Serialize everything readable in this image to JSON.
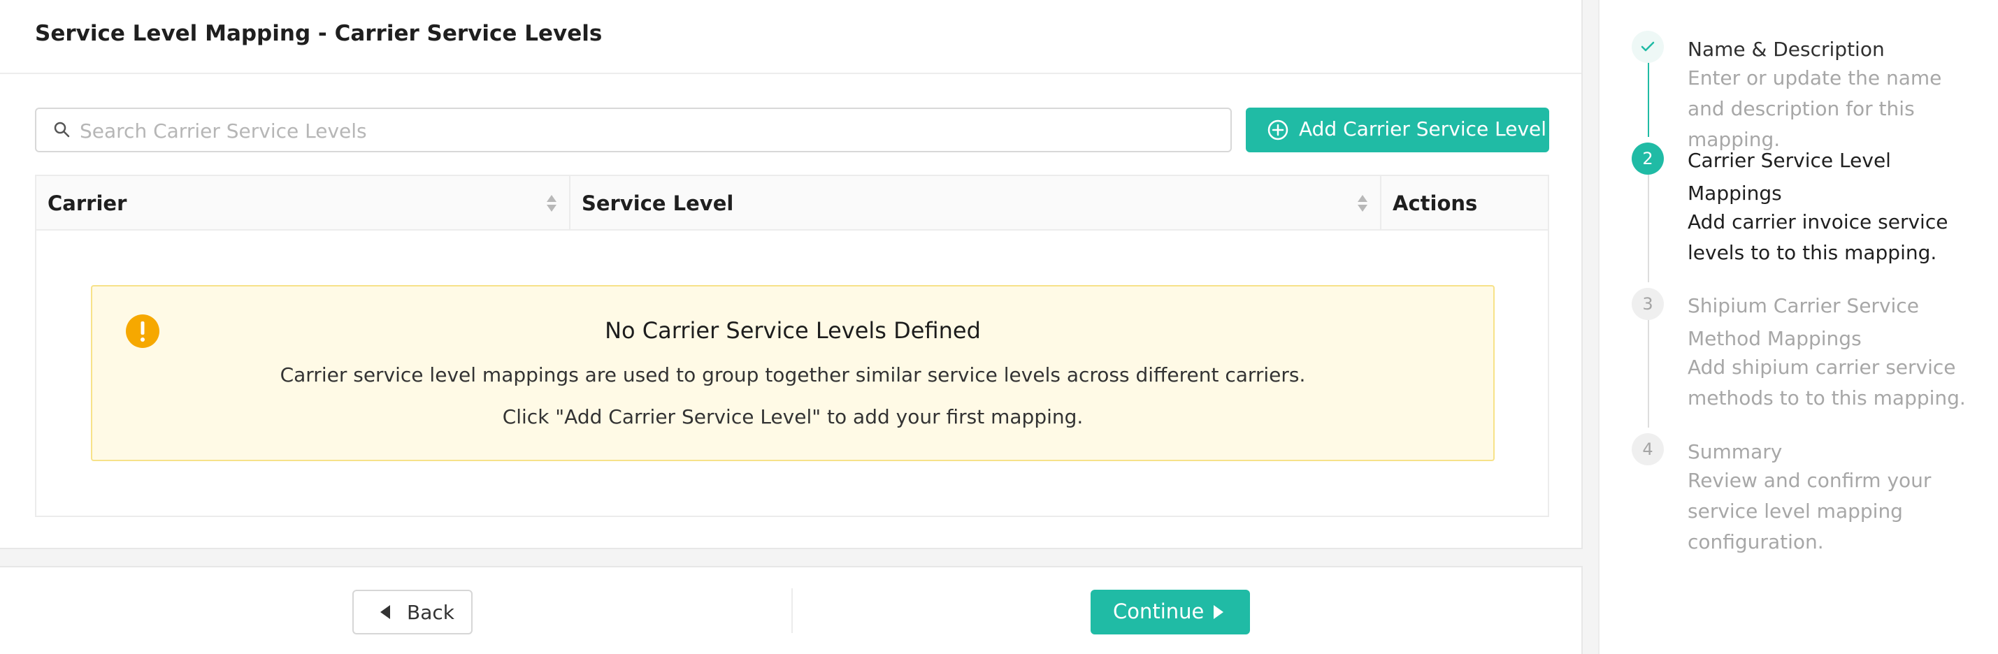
{
  "header": {
    "title": "Service Level Mapping - Carrier Service Levels"
  },
  "search": {
    "placeholder": "Search Carrier Service Levels",
    "value": "",
    "icon": "search-icon"
  },
  "toolbar": {
    "add_label": "Add Carrier Service Level",
    "add_icon": "plus-circle-icon",
    "accent_color": "#20bba5"
  },
  "table": {
    "columns": [
      {
        "label": "Carrier",
        "sortable": true
      },
      {
        "label": "Service Level",
        "sortable": true
      },
      {
        "label": "Actions",
        "sortable": false
      }
    ],
    "rows": []
  },
  "empty_state": {
    "title": "No Carrier Service Levels Defined",
    "line1": "Carrier service level mappings are used to group together similar service levels across different carriers.",
    "line2": "Click \"Add Carrier Service Level\" to add your first mapping.",
    "icon": "warning-icon",
    "background": "#fffae6",
    "border": "#f7e289",
    "icon_color": "#f6a800"
  },
  "footer": {
    "back_label": "Back",
    "continue_label": "Continue",
    "back_icon": "triangle-left-icon",
    "continue_icon": "triangle-right-icon"
  },
  "stepper": {
    "steps": [
      {
        "status": "completed",
        "indicator": "",
        "title": "Name & Description",
        "description": "Enter or update the name and description for this mapping."
      },
      {
        "status": "active",
        "indicator": "2",
        "title": "Carrier Service Level Mappings",
        "description": "Add carrier invoice service levels to to this mapping."
      },
      {
        "status": "inactive",
        "indicator": "3",
        "title": "Shipium Carrier Service Method Mappings",
        "description": "Add shipium carrier service methods to to this mapping."
      },
      {
        "status": "inactive",
        "indicator": "4",
        "title": "Summary",
        "description": "Review and confirm your service level mapping configuration."
      }
    ]
  }
}
